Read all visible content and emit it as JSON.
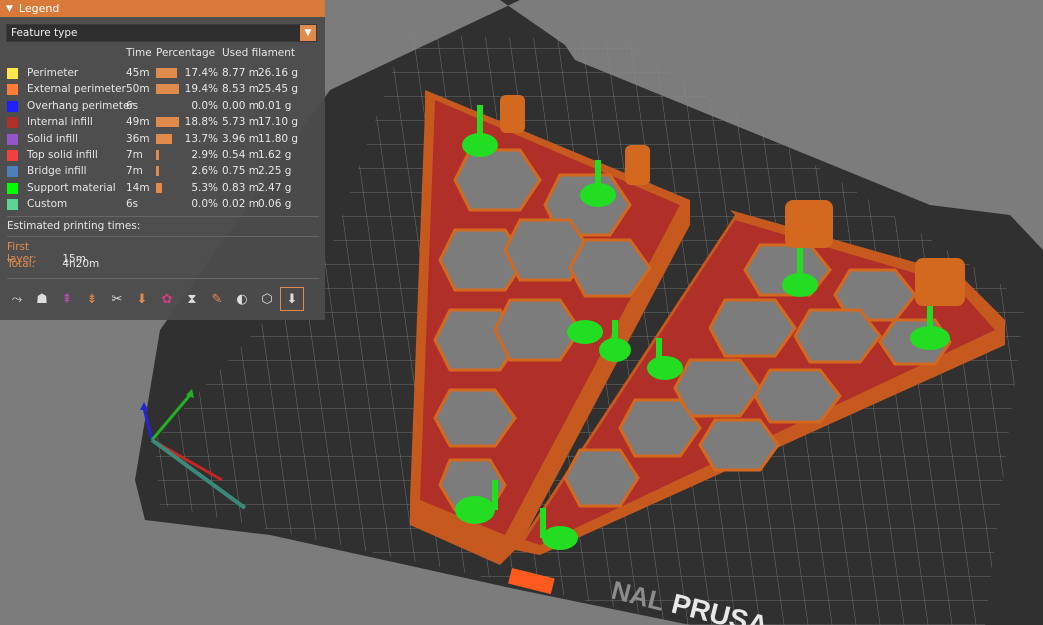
{
  "legend": {
    "title": "Legend",
    "view_type": "Feature type",
    "columns": {
      "time": "Time",
      "percentage": "Percentage",
      "used_filament": "Used filament"
    },
    "features": [
      {
        "name": "Perimeter",
        "color": "#ffe64d",
        "time": "45m",
        "percent_value": 17.4,
        "percent": "17.4%",
        "length": "8.77 m",
        "weight": "26.16 g"
      },
      {
        "name": "External perimeter",
        "color": "#ff7d38",
        "time": "50m",
        "percent_value": 19.4,
        "percent": "19.4%",
        "length": "8.53 m",
        "weight": "25.45 g"
      },
      {
        "name": "Overhang perimeter",
        "color": "#1f1fff",
        "time": "6s",
        "percent_value": 0.0,
        "percent": "0.0%",
        "length": "0.00 m",
        "weight": "0.01 g"
      },
      {
        "name": "Internal infill",
        "color": "#b03029",
        "time": "49m",
        "percent_value": 18.8,
        "percent": "18.8%",
        "length": "5.73 m",
        "weight": "17.10 g"
      },
      {
        "name": "Solid infill",
        "color": "#9654cc",
        "time": "36m",
        "percent_value": 13.7,
        "percent": "13.7%",
        "length": "3.96 m",
        "weight": "11.80 g"
      },
      {
        "name": "Top solid infill",
        "color": "#f04040",
        "time": "7m",
        "percent_value": 2.9,
        "percent": "2.9%",
        "length": "0.54 m",
        "weight": "1.62 g"
      },
      {
        "name": "Bridge infill",
        "color": "#4d80ba",
        "time": "7m",
        "percent_value": 2.6,
        "percent": "2.6%",
        "length": "0.75 m",
        "weight": "2.25 g"
      },
      {
        "name": "Support material",
        "color": "#00ff00",
        "time": "14m",
        "percent_value": 5.3,
        "percent": "5.3%",
        "length": "0.83 m",
        "weight": "2.47 g"
      },
      {
        "name": "Custom",
        "color": "#5ed194",
        "time": "6s",
        "percent_value": 0.0,
        "percent": "0.0%",
        "length": "0.02 m",
        "weight": "0.06 g"
      }
    ],
    "estimated_label": "Estimated printing times:",
    "first_layer_label": "First layer:",
    "first_layer_value": "15m",
    "total_label": "Total:",
    "total_value": "4h20m",
    "toolbar_icons": [
      "travel-icon",
      "wipe-icon",
      "retractions-icon",
      "deretractions-icon",
      "seams-icon",
      "tool-changes-icon",
      "color-changes-icon",
      "pause-prints-icon",
      "custom-gcodes-icon",
      "center-of-gravity-icon",
      "shells-icon",
      "tool-marker-icon"
    ]
  },
  "scene": {
    "bed_text": "PRUSA",
    "bed_text_partial": "NAL",
    "bed_color": "#2d2d2d",
    "part_color": "#d2691e",
    "infill_color": "#b03029",
    "support_color": "#22dd22"
  }
}
